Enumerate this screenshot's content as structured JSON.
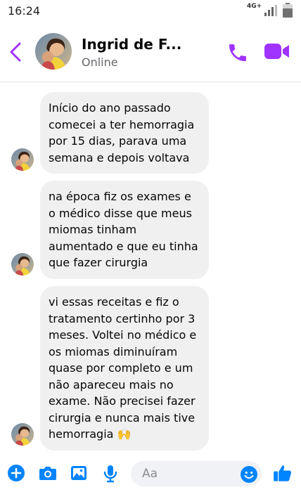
{
  "status_bar": {
    "time": "16:24",
    "network": "4G+",
    "icons": [
      "signal-icon",
      "battery-icon"
    ]
  },
  "header": {
    "name": "Ingrid de F...",
    "status": "Online",
    "icons": [
      "back-arrow-icon",
      "phone-call-icon",
      "video-call-icon"
    ],
    "accent_color": "#a033ff"
  },
  "messages": [
    {
      "text": "Início do ano passado comecei a ter hemorragia por 15 dias, parava uma semana e depois voltava"
    },
    {
      "text": "na época fiz os exames e o médico disse que meus miomas tinham aumentado e que eu tinha que fazer cirurgia"
    },
    {
      "text": "vi essas receitas e fiz o tratamento certinho por 3 meses. Voltei no médico e os miomas diminuíram quase por completo e um não apareceu mais no exame. Não precisei fazer cirurgia e nunca mais tive hemorragia 🙌"
    }
  ],
  "composer": {
    "placeholder": "Aa",
    "icons": [
      "plus-icon",
      "camera-icon",
      "gallery-icon",
      "microphone-icon",
      "emoji-icon",
      "thumbs-up-icon"
    ],
    "accent_color": "#0084ff"
  },
  "bubble_color": "#f0f0f0"
}
